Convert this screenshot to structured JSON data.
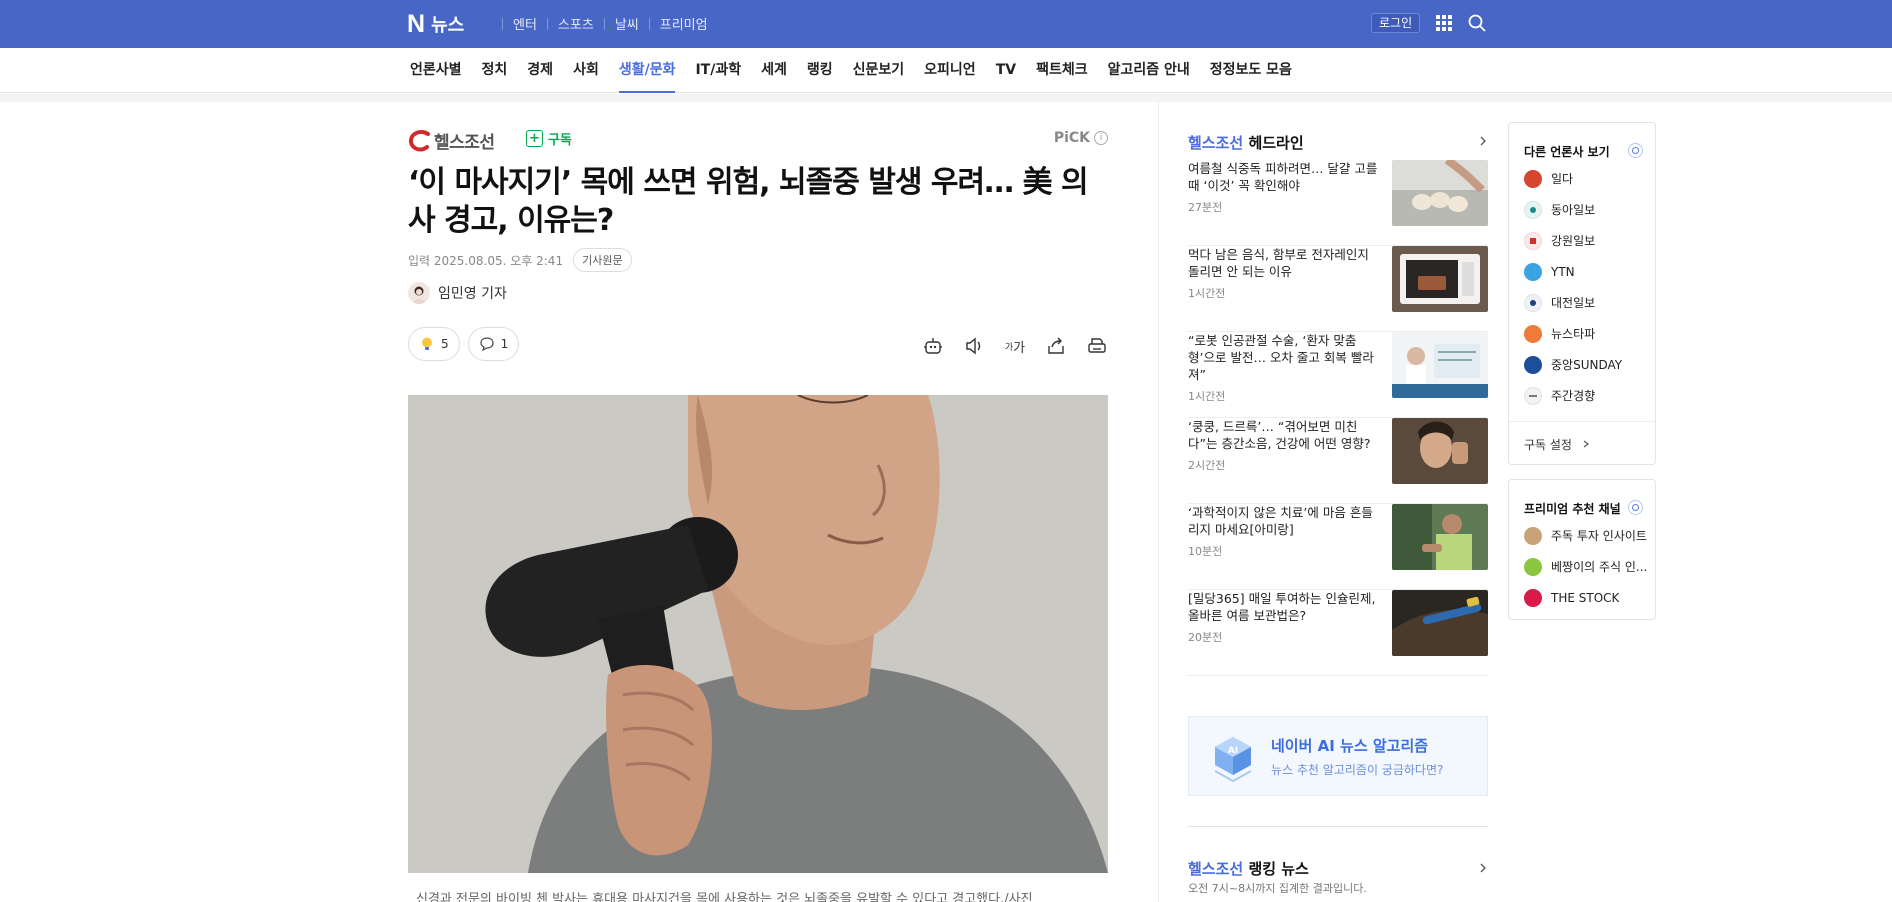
{
  "topbar": {
    "logo_letter": "N",
    "logo_text": "뉴스",
    "nav": [
      "엔터",
      "스포츠",
      "날씨",
      "프리미엄"
    ],
    "login": "로그인"
  },
  "sections": [
    "언론사별",
    "정치",
    "경제",
    "사회",
    "생활/문화",
    "IT/과학",
    "세계",
    "랭킹",
    "신문보기",
    "오피니언",
    "TV",
    "팩트체크",
    "알고리즘 안내",
    "정정보도 모음"
  ],
  "article": {
    "press": "헬스조선",
    "subscribe": "구독",
    "pick": "PiCK",
    "pick_info": "i",
    "title": "‘이 마사지기’ 목에 쓰면 위험, 뇌졸중 발생 우려… 美 의사 경고, 이유는?",
    "date": "입력 2025.08.05. 오후 2:41",
    "original_link": "기사원문",
    "reporter": "임민영 기자",
    "reaction_count": "5",
    "comment_count": "1",
    "font_tool": "가",
    "font_tool_prefix": "가",
    "caption": "신경과 전문의 바이빙 첸 박사는 휴대용 마사지건을 목에 사용하는 것은 뇌졸중을 유발할 수 있다고 경고했다./사진"
  },
  "headlines": {
    "brand": "헬스조선",
    "title": "헤드라인",
    "items": [
      {
        "title": "여름철 식중독 피하려면… 달걀 고를 때 ‘이것’ 꼭 확인해야",
        "time": "27분전"
      },
      {
        "title": "먹다 남은 음식, 함부로 전자레인지 돌리면 안 되는 이유",
        "time": "1시간전"
      },
      {
        "title": "“로봇 인공관절 수술, ‘환자 맞춤형’으로 발전… 오차 줄고 회복 빨라져”",
        "time": "1시간전"
      },
      {
        "title": "‘쿵쿵, 드르륵’… “겪어보면 미친다”는 층간소음, 건강에 어떤 영향?",
        "time": "2시간전"
      },
      {
        "title": "‘과학적이지 않은 치료’에 마음 흔들리지 마세요[아미랑]",
        "time": "10분전"
      },
      {
        "title": "[밀당365] 매일 투여하는 인슐린제, 올바른 여름 보관법은?",
        "time": "20분전"
      }
    ]
  },
  "ai_box": {
    "title": "네이버 AI 뉴스 알고리즘",
    "subtitle": "뉴스 추천 알고리즘이 궁금하다면?",
    "cube_label": "AI"
  },
  "ranking": {
    "brand": "헬스조선",
    "title": "랭킹 뉴스",
    "note": "오전 7시~8시까지 집계한 결과입니다."
  },
  "other_press": {
    "title": "다른 언론사 보기",
    "items": [
      {
        "name": "일다",
        "color": "#d6452f"
      },
      {
        "name": "동아일보",
        "color": "#e8f3f3"
      },
      {
        "name": "강원일보",
        "color": "#fbeaea"
      },
      {
        "name": "YTN",
        "color": "#3aa3e3"
      },
      {
        "name": "대전일보",
        "color": "#eef2f6"
      },
      {
        "name": "뉴스타파",
        "color": "#f07a3a"
      },
      {
        "name": "중앙SUNDAY",
        "color": "#1d4e9a"
      },
      {
        "name": "주간경향",
        "color": "#f2f2f2"
      }
    ],
    "footer": "구독 설정"
  },
  "premium": {
    "title": "프리미엄 추천 채널",
    "items": [
      {
        "name": "주독 투자 인사이트",
        "color": "#c9a27a"
      },
      {
        "name": "베짱이의 주식 인...",
        "color": "#8cc63f"
      },
      {
        "name": "THE STOCK",
        "color": "#d81b4a"
      }
    ]
  }
}
